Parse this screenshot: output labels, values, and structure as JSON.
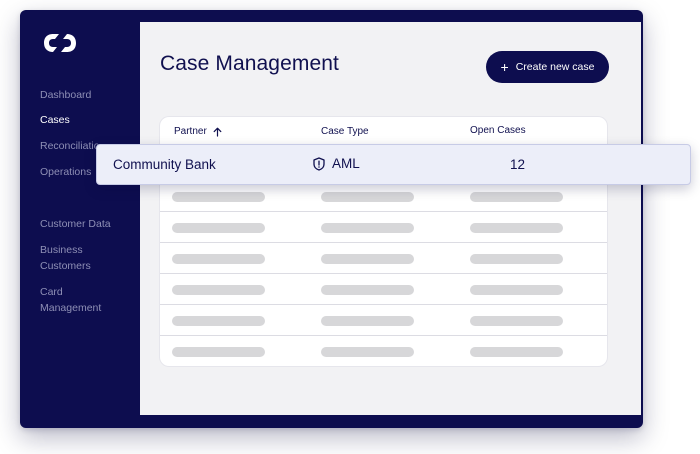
{
  "app": {
    "logo_icon": "chain-link-icon",
    "brand_color": "#0d0d4f"
  },
  "sidebar": {
    "items": [
      {
        "label": "Dashboard",
        "active": false
      },
      {
        "label": "Cases",
        "active": true
      },
      {
        "label": "Reconciliation",
        "active": false
      },
      {
        "label": "Operations",
        "active": false
      },
      {
        "label": "Customer Data",
        "active": false
      },
      {
        "label": "Business Customers",
        "active": false
      },
      {
        "label": "Card Management",
        "active": false
      }
    ]
  },
  "main": {
    "title": "Case Management",
    "create_button": {
      "label": "Create new case",
      "icon": "plus-icon"
    }
  },
  "table": {
    "columns": [
      {
        "label": "Partner",
        "sort_icon": "arrow-up-icon"
      },
      {
        "label": "Case Type"
      },
      {
        "label": "Open Cases"
      }
    ],
    "highlighted_row": {
      "partner": "Community Bank",
      "case_type": "AML",
      "case_type_icon": "shield-icon",
      "open_cases": "12"
    },
    "placeholder_rows": 6
  }
}
